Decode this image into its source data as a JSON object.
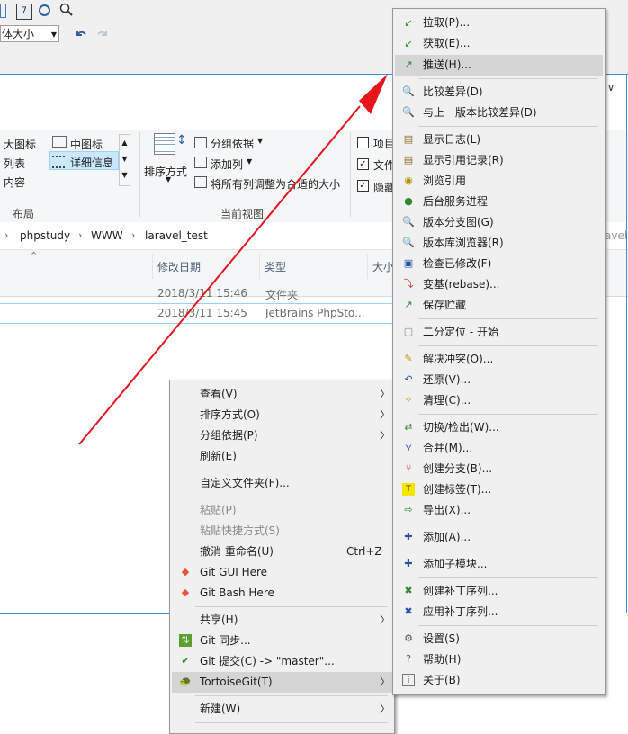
{
  "toolbar": {
    "font_size_value": "体大小"
  },
  "ribbon": {
    "layout": {
      "items": [
        "大图标",
        "中图标",
        "列表",
        "详细信息",
        "内容"
      ],
      "group_label": "布局"
    },
    "current_view": {
      "sort_label": "排序方式",
      "group_by": "分组依据",
      "add_column": "添加列",
      "fit_columns": "将所有列调整为合适的大小",
      "group_label": "当前视图"
    },
    "show_hide": {
      "items": [
        "项目",
        "文件",
        "隐藏"
      ]
    }
  },
  "breadcrumb": [
    "phpstudy",
    "WWW",
    "laravel_test"
  ],
  "breadcrumb_tail": "avel...",
  "columns": {
    "modified": "修改日期",
    "type": "类型",
    "size": "大小"
  },
  "rows": [
    {
      "modified": "2018/3/11 15:46",
      "type": "文件夹"
    },
    {
      "modified": "2018/3/11 15:45",
      "type": "JetBrains PhpSto..."
    }
  ],
  "context_menu": {
    "items": [
      {
        "label": "查看(V)",
        "submenu": true
      },
      {
        "label": "排序方式(O)",
        "submenu": true
      },
      {
        "label": "分组依据(P)",
        "submenu": true
      },
      {
        "label": "刷新(E)"
      },
      {
        "label": "自定义文件夹(F)..."
      },
      {
        "label": "粘贴(P)",
        "disabled": true
      },
      {
        "label": "粘贴快捷方式(S)",
        "disabled": true
      },
      {
        "label": "撤消 重命名(U)",
        "shortcut": "Ctrl+Z"
      },
      {
        "label": "Git GUI Here"
      },
      {
        "label": "Git Bash Here"
      },
      {
        "label": "共享(H)",
        "submenu": true
      },
      {
        "label": "Git 同步..."
      },
      {
        "label": "Git 提交(C) -> \"master\"..."
      },
      {
        "label": "TortoiseGit(T)",
        "submenu": true,
        "highlighted": true
      },
      {
        "label": "新建(W)",
        "submenu": true
      }
    ]
  },
  "tortoise_menu": {
    "items": [
      {
        "label": "拉取(P)...",
        "icon": "pull-arrow-icon"
      },
      {
        "label": "获取(E)...",
        "icon": "fetch-arrow-icon"
      },
      {
        "label": "推送(H)...",
        "icon": "push-arrow-icon",
        "highlighted": true
      },
      {
        "label": "比较差异(D)",
        "icon": "diff-magnifier-icon"
      },
      {
        "label": "与上一版本比较差异(D)",
        "icon": "diff-previous-icon"
      },
      {
        "label": "显示日志(L)",
        "icon": "log-icon"
      },
      {
        "label": "显示引用记录(R)",
        "icon": "reflog-icon"
      },
      {
        "label": "浏览引用",
        "icon": "browse-refs-icon"
      },
      {
        "label": "后台服务进程",
        "icon": "daemon-icon"
      },
      {
        "label": "版本分支图(G)",
        "icon": "revision-graph-icon"
      },
      {
        "label": "版本库浏览器(R)",
        "icon": "repo-browser-icon"
      },
      {
        "label": "检查已修改(F)",
        "icon": "check-modifications-icon"
      },
      {
        "label": "变基(rebase)...",
        "icon": "rebase-icon"
      },
      {
        "label": "保存贮藏",
        "icon": "stash-icon"
      },
      {
        "label": "二分定位 - 开始",
        "icon": "bisect-icon"
      },
      {
        "label": "解决冲突(O)...",
        "icon": "resolve-icon"
      },
      {
        "label": "还原(V)...",
        "icon": "revert-icon"
      },
      {
        "label": "清理(C)...",
        "icon": "cleanup-icon"
      },
      {
        "label": "切换/检出(W)...",
        "icon": "switch-icon"
      },
      {
        "label": "合并(M)...",
        "icon": "merge-icon"
      },
      {
        "label": "创建分支(B)...",
        "icon": "branch-icon"
      },
      {
        "label": "创建标签(T)...",
        "icon": "tag-icon"
      },
      {
        "label": "导出(X)...",
        "icon": "export-icon"
      },
      {
        "label": "添加(A)...",
        "icon": "add-icon"
      },
      {
        "label": "添加子模块...",
        "icon": "submodule-add-icon"
      },
      {
        "label": "创建补丁序列...",
        "icon": "create-patch-icon"
      },
      {
        "label": "应用补丁序列...",
        "icon": "apply-patch-icon"
      },
      {
        "label": "设置(S)",
        "icon": "settings-icon"
      },
      {
        "label": "帮助(H)",
        "icon": "help-icon"
      },
      {
        "label": "关于(B)",
        "icon": "about-icon"
      }
    ]
  },
  "colors": {
    "arrow": "#e8141b",
    "accent": "#3c8bd9",
    "menu_bg": "#f0f0f0",
    "highlight": "#d5d5d5"
  }
}
